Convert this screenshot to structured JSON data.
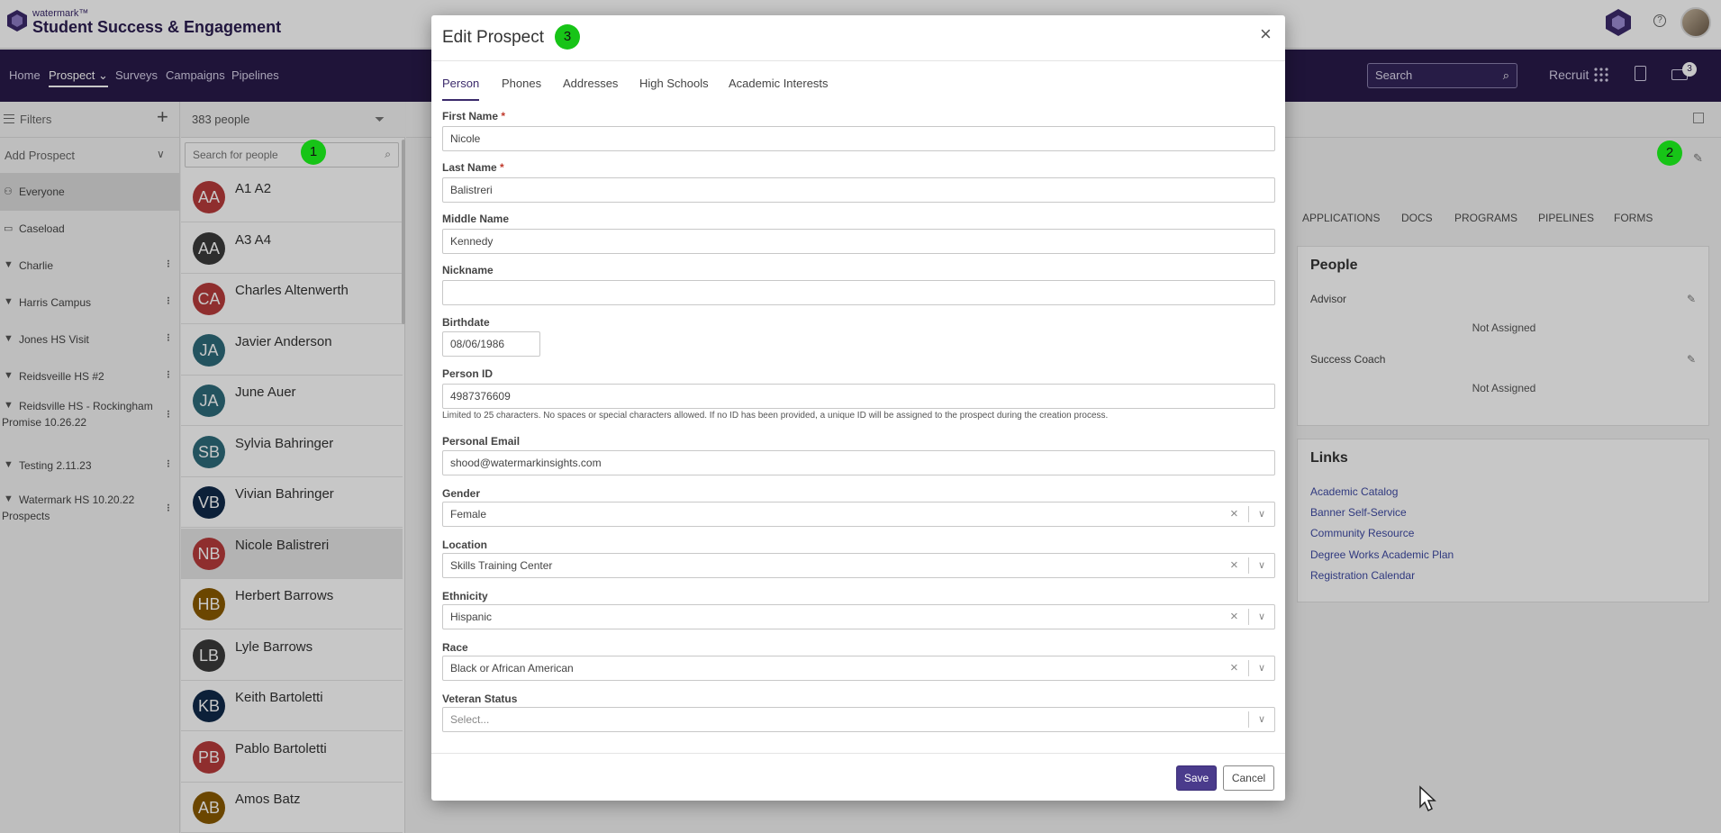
{
  "header": {
    "brand_small": "watermark™",
    "brand_title": "Student Success & Engagement",
    "help_glyph": "?"
  },
  "nav": {
    "items": [
      "Home",
      "Prospect",
      "Surveys",
      "Campaigns",
      "Pipelines"
    ],
    "active": "Prospect",
    "search_placeholder": "Search",
    "recruit_label": "Recruit",
    "inbox_count": "3"
  },
  "filters": {
    "title": "Filters",
    "add_prospect": "Add Prospect",
    "items": [
      {
        "label": "Everyone",
        "icon": "people-icon"
      },
      {
        "label": "Caseload",
        "icon": "briefcase-icon"
      },
      {
        "label": "Charlie",
        "icon": "filter-icon"
      },
      {
        "label": "Harris Campus",
        "icon": "filter-icon"
      },
      {
        "label": "Jones HS Visit",
        "icon": "filter-icon"
      },
      {
        "label": "Reidsveille HS #2",
        "icon": "filter-icon"
      },
      {
        "label": "Reidsville HS - Rockingham Promise 10.26.22",
        "icon": "filter-icon"
      },
      {
        "label": "Testing 2.11.23",
        "icon": "filter-icon"
      },
      {
        "label": "Watermark HS 10.20.22 Prospects",
        "icon": "filter-icon"
      }
    ]
  },
  "people": {
    "count_label": "383 people",
    "search_placeholder": "Search for people",
    "list": [
      {
        "initials": "AA",
        "name": "A1 A2",
        "color": "#b83c3c"
      },
      {
        "initials": "AA",
        "name": "A3 A4",
        "color": "#3a3a3a"
      },
      {
        "initials": "CA",
        "name": "Charles Altenwerth",
        "color": "#b83c3c"
      },
      {
        "initials": "JA",
        "name": "Javier Anderson",
        "color": "#2e6b7a"
      },
      {
        "initials": "JA",
        "name": "June Auer",
        "color": "#2e6b7a"
      },
      {
        "initials": "SB",
        "name": "Sylvia Bahringer",
        "color": "#2e6b7a"
      },
      {
        "initials": "VB",
        "name": "Vivian Bahringer",
        "color": "#102a4a"
      },
      {
        "initials": "NB",
        "name": "Nicole Balistreri",
        "color": "#b83c3c"
      },
      {
        "initials": "HB",
        "name": "Herbert Barrows",
        "color": "#8a5a00"
      },
      {
        "initials": "LB",
        "name": "Lyle Barrows",
        "color": "#3a3a3a"
      },
      {
        "initials": "KB",
        "name": "Keith Bartoletti",
        "color": "#102a4a"
      },
      {
        "initials": "PB",
        "name": "Pablo Bartoletti",
        "color": "#b83c3c"
      },
      {
        "initials": "AB",
        "name": "Amos Batz",
        "color": "#8a5a00"
      }
    ]
  },
  "profile_tabs": [
    "APPLICATIONS",
    "DOCS",
    "PROGRAMS",
    "PIPELINES",
    "FORMS"
  ],
  "people_panel": {
    "title": "People",
    "advisor_label": "Advisor",
    "advisor_value": "Not Assigned",
    "coach_label": "Success Coach",
    "coach_value": "Not Assigned"
  },
  "links_panel": {
    "title": "Links",
    "links": [
      "Academic Catalog",
      "Banner Self-Service",
      "Community Resource",
      "Degree Works Academic Plan",
      "Registration Calendar"
    ]
  },
  "modal": {
    "title": "Edit Prospect",
    "tabs": [
      "Person",
      "Phones",
      "Addresses",
      "High Schools",
      "Academic Interests"
    ],
    "active_tab": "Person",
    "fields": {
      "first_name": {
        "label": "First Name",
        "required": "*",
        "value": "Nicole"
      },
      "last_name": {
        "label": "Last Name",
        "required": "*",
        "value": "Balistreri"
      },
      "middle_name": {
        "label": "Middle Name",
        "value": "Kennedy"
      },
      "nickname": {
        "label": "Nickname",
        "value": ""
      },
      "birthdate": {
        "label": "Birthdate",
        "value": "08/06/1986"
      },
      "person_id": {
        "label": "Person ID",
        "value": "4987376609",
        "hint": "Limited to 25 characters. No spaces or special characters allowed. If no ID has been provided, a unique ID will be assigned to the prospect during the creation process."
      },
      "email": {
        "label": "Personal Email",
        "value": "shood@watermarkinsights.com"
      },
      "gender": {
        "label": "Gender",
        "value": "Female"
      },
      "location": {
        "label": "Location",
        "value": "Skills Training Center"
      },
      "ethnicity": {
        "label": "Ethnicity",
        "value": "Hispanic"
      },
      "race": {
        "label": "Race",
        "value": "Black or African American"
      },
      "veteran": {
        "label": "Veteran Status",
        "placeholder": "Select..."
      }
    },
    "save_label": "Save",
    "cancel_label": "Cancel"
  },
  "annotations": [
    "1",
    "2",
    "3"
  ],
  "colors": {
    "nav_bg": "#281a4a",
    "primary": "#4a3b8c",
    "badge": "#17c417",
    "required": "#c0392b"
  }
}
